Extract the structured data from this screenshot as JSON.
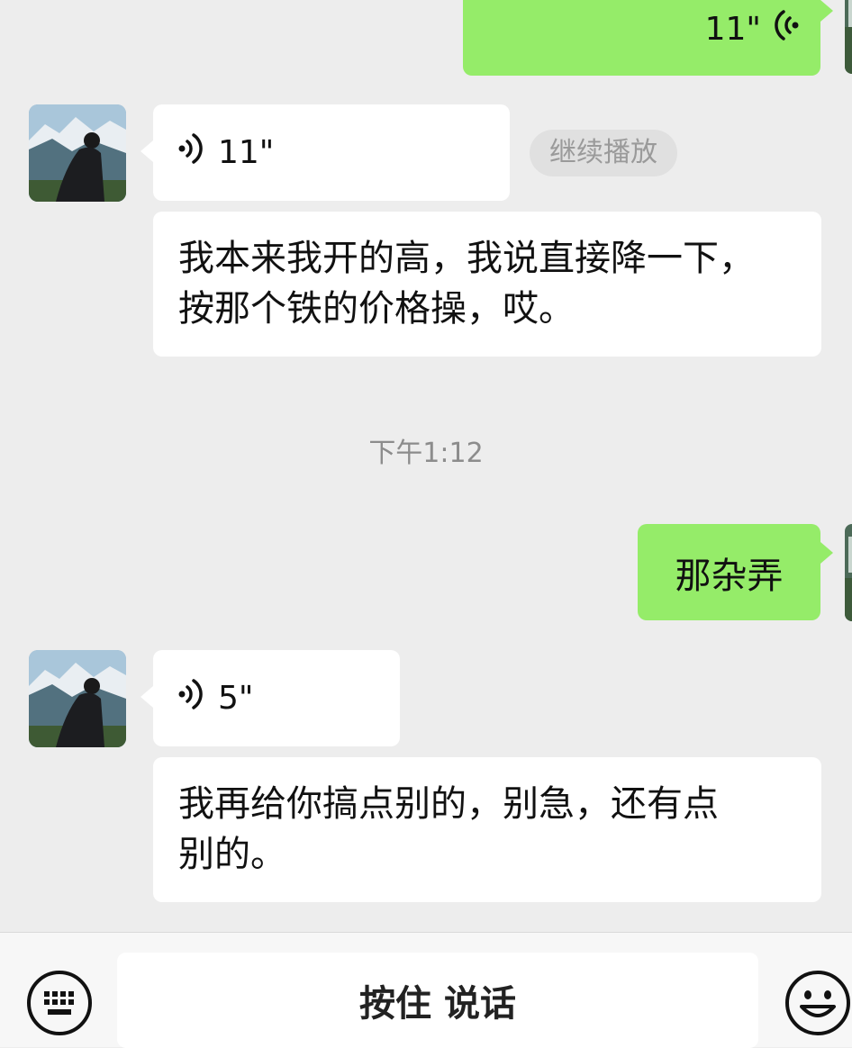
{
  "messages": {
    "top_voice_duration": "11\"",
    "voice1_duration": "11\"",
    "continue_label": "继续播放",
    "text1_line1": "我本来我开的高，我说直接降一下，",
    "text1_line2": "按那个铁的价格操，哎。",
    "timestamp": "下午1:12",
    "sent_text": "那杂弄",
    "voice2_duration": "5\"",
    "text2_line1": "我再给你搞点别的，别急，还有点",
    "text2_line2": "别的。"
  },
  "input_bar": {
    "hold_to_talk_label": "按住 说话",
    "left_icon": "keyboard-icon",
    "right_icon": "emoji-icon"
  },
  "colors": {
    "background": "#ededed",
    "sent_bubble": "#95ec69",
    "received_bubble": "#ffffff"
  }
}
